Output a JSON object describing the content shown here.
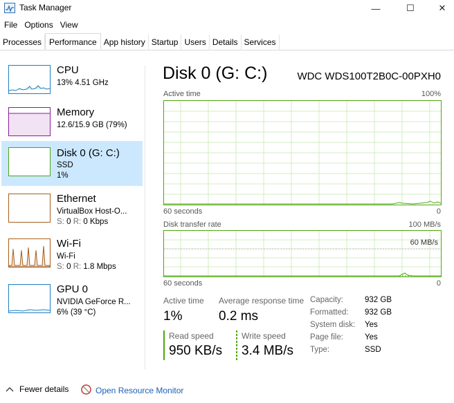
{
  "window": {
    "title": "Task Manager",
    "minimize": "—",
    "maximize": "☐",
    "close": "✕"
  },
  "menu": [
    "File",
    "Options",
    "View"
  ],
  "tabs": [
    "Processes",
    "Performance",
    "App history",
    "Startup",
    "Users",
    "Details",
    "Services"
  ],
  "sidebar": {
    "items": [
      {
        "name": "CPU",
        "sub1": "13%  4.51 GHz",
        "sub2": "",
        "color": "#1a7fbf"
      },
      {
        "name": "Memory",
        "sub1": "12.6/15.9 GB (79%)",
        "sub2": "",
        "color": "#8b1a9b"
      },
      {
        "name": "Disk 0 (G: C:)",
        "sub1": "SSD",
        "sub2": "1%",
        "color": "#4da60c"
      },
      {
        "name": "Ethernet",
        "sub1": "VirtualBox Host-O...",
        "sub2_label_s": "S:",
        "sub2_s": "0",
        "sub2_label_r": "R:",
        "sub2_r": "0 Kbps",
        "color": "#a75d1c"
      },
      {
        "name": "Wi-Fi",
        "sub1": "Wi-Fi",
        "sub2_label_s": "S:",
        "sub2_s": "0",
        "sub2_label_r": "R:",
        "sub2_r": "1.8 Mbps",
        "color": "#a75d1c"
      },
      {
        "name": "GPU 0",
        "sub1": "NVIDIA GeForce R...",
        "sub2": "6% (39 °C)",
        "color": "#1a7fbf"
      }
    ]
  },
  "main": {
    "title": "Disk 0 (G: C:)",
    "model": "WDC WDS100T2B0C-00PXH0",
    "active_time_graph": {
      "label": "Active time",
      "max": "100%",
      "x_left": "60 seconds",
      "x_right": "0"
    },
    "transfer_graph": {
      "label": "Disk transfer rate",
      "max": "100 MB/s",
      "mid": "60 MB/s",
      "x_left": "60 seconds",
      "x_right": "0"
    },
    "stats": {
      "active_time_label": "Active time",
      "active_time_value": "1%",
      "avg_resp_label": "Average response time",
      "avg_resp_value": "0.2 ms",
      "read_label": "Read speed",
      "read_value": "950 KB/s",
      "write_label": "Write speed",
      "write_value": "3.4 MB/s"
    },
    "properties": [
      {
        "label": "Capacity:",
        "value": "932 GB"
      },
      {
        "label": "Formatted:",
        "value": "932 GB"
      },
      {
        "label": "System disk:",
        "value": "Yes"
      },
      {
        "label": "Page file:",
        "value": "Yes"
      },
      {
        "label": "Type:",
        "value": "SSD"
      }
    ]
  },
  "footer": {
    "fewer_details": "Fewer details",
    "open_monitor": "Open Resource Monitor"
  },
  "colors": {
    "disk_green": "#4da60c",
    "selected_bg": "#cce8ff",
    "link": "#1a5fb4"
  }
}
